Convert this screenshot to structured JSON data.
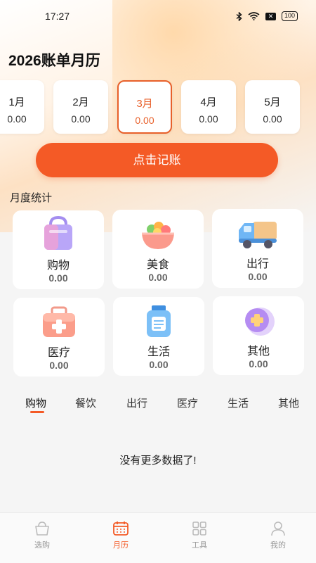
{
  "status_bar": {
    "time": "17:27",
    "battery": "100",
    "mute": "✕"
  },
  "title": "2026账单月历",
  "months": [
    {
      "name": "1月",
      "value": "0.00",
      "active": false
    },
    {
      "name": "2月",
      "value": "0.00",
      "active": false
    },
    {
      "name": "3月",
      "value": "0.00",
      "active": true
    },
    {
      "name": "4月",
      "value": "0.00",
      "active": false
    },
    {
      "name": "5月",
      "value": "0.00",
      "active": false
    }
  ],
  "record_button": "点击记账",
  "stats": {
    "title": "月度统计",
    "categories": [
      {
        "name": "购物",
        "value": "0.00",
        "icon": "shopping-bag-icon"
      },
      {
        "name": "美食",
        "value": "0.00",
        "icon": "food-bowl-icon"
      },
      {
        "name": "出行",
        "value": "0.00",
        "icon": "truck-icon"
      },
      {
        "name": "医疗",
        "value": "0.00",
        "icon": "medical-kit-icon"
      },
      {
        "name": "生活",
        "value": "0.00",
        "icon": "jar-icon"
      },
      {
        "name": "其他",
        "value": "0.00",
        "icon": "plus-badge-icon"
      }
    ]
  },
  "tabs": [
    {
      "label": "购物",
      "active": true
    },
    {
      "label": "餐饮",
      "active": false
    },
    {
      "label": "出行",
      "active": false
    },
    {
      "label": "医疗",
      "active": false
    },
    {
      "label": "生活",
      "active": false
    },
    {
      "label": "其他",
      "active": false
    }
  ],
  "empty_message": "没有更多数据了!",
  "bottom_nav": [
    {
      "label": "选购",
      "icon": "basket-icon",
      "active": false
    },
    {
      "label": "月历",
      "icon": "calendar-icon",
      "active": true
    },
    {
      "label": "工具",
      "icon": "grid-icon",
      "active": false
    },
    {
      "label": "我的",
      "icon": "user-icon",
      "active": false
    }
  ],
  "colors": {
    "accent": "#f45a26",
    "active_month": "#e8602a",
    "background": "#f5f5f5"
  }
}
